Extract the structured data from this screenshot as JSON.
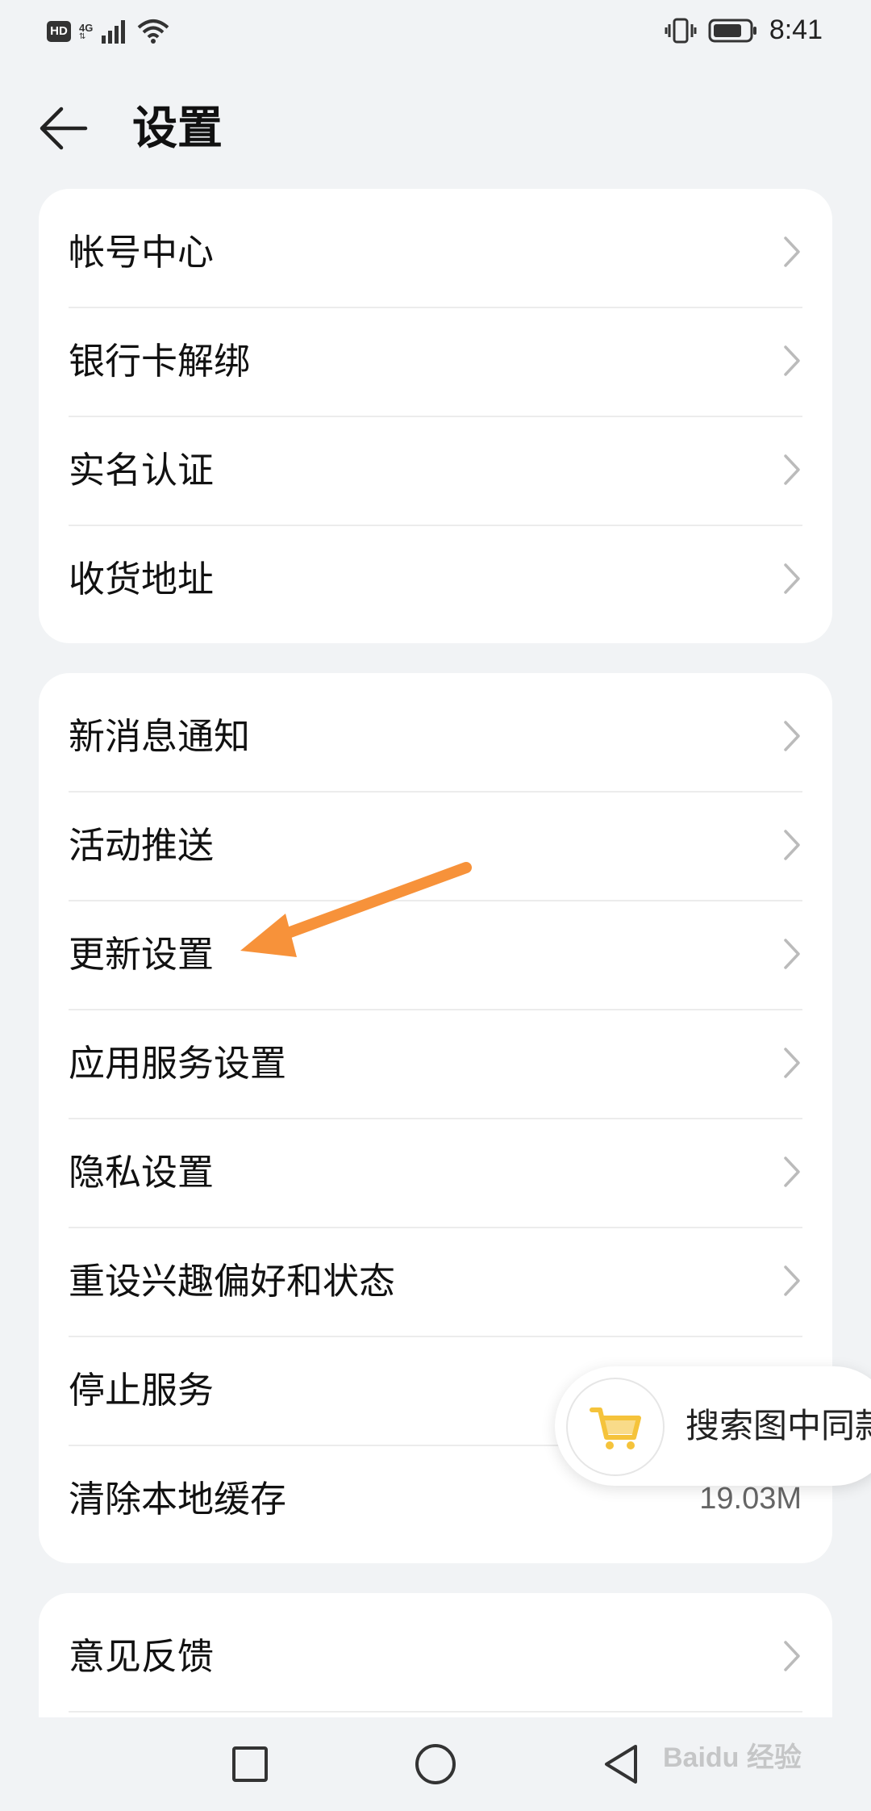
{
  "status_bar": {
    "hd_badge": "HD",
    "network": "4G",
    "time": "8:41"
  },
  "header": {
    "title": "设置"
  },
  "groups": [
    {
      "items": [
        {
          "label": "帐号中心"
        },
        {
          "label": "银行卡解绑"
        },
        {
          "label": "实名认证"
        },
        {
          "label": "收货地址"
        }
      ]
    },
    {
      "items": [
        {
          "label": "新消息通知"
        },
        {
          "label": "活动推送"
        },
        {
          "label": "更新设置"
        },
        {
          "label": "应用服务设置"
        },
        {
          "label": "隐私设置"
        },
        {
          "label": "重设兴趣偏好和状态"
        },
        {
          "label": "停止服务"
        },
        {
          "label": "清除本地缓存",
          "value": "19.03M"
        }
      ]
    },
    {
      "items": [
        {
          "label": "意见反馈"
        }
      ]
    }
  ],
  "floating_search": {
    "label": "搜索图中同款"
  },
  "annotation": {
    "arrow_color": "#f7923a"
  },
  "watermark": {
    "text": "Baidu 经验"
  },
  "icons": [
    "back-arrow-icon",
    "chevron-right-icon",
    "shopping-cart-icon",
    "vibrate-icon",
    "battery-icon",
    "wifi-icon",
    "signal-icon",
    "recent-apps-icon",
    "home-icon",
    "back-nav-icon"
  ]
}
